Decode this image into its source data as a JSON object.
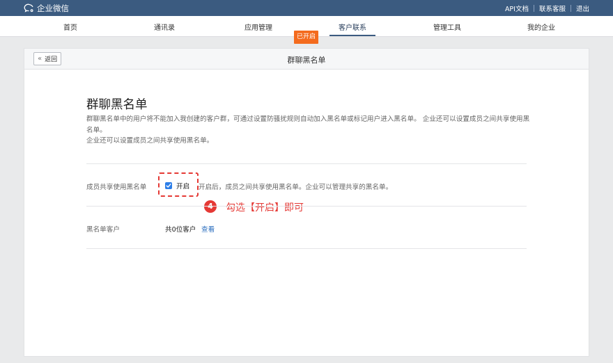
{
  "topbar": {
    "app_name": "企业微信",
    "links": [
      "API文档",
      "联系客服",
      "退出"
    ]
  },
  "nav": {
    "items": [
      "首页",
      "通讯录",
      "应用管理",
      "客户联系",
      "管理工具",
      "我的企业"
    ],
    "active_index": 3,
    "badge": "已开启"
  },
  "panel": {
    "back_label": "返回",
    "title": "群聊黑名单"
  },
  "content": {
    "heading": "群聊黑名单",
    "desc_line1": "群聊黑名单中的用户将不能加入我创建的客户群，可通过设置防骚扰规则自动加入黑名单或标记用户进入黑名单。 企业还可以设置成员之间共享使用黑名单。",
    "desc_line2": "企业还可以设置成员之间共享使用黑名单。",
    "share": {
      "label": "成员共享使用黑名单",
      "checkbox_label": "开启",
      "checked": true,
      "hint": "开启后，成员之间共享使用黑名单。企业可以管理共享的黑名单。"
    },
    "annotation": {
      "number": "4",
      "text": "勾选【开启】即可"
    },
    "blacklist": {
      "label": "黑名单客户",
      "count": "共0位客户",
      "link": "查看"
    }
  },
  "colors": {
    "topbar": "#3b5b80",
    "badge": "#f46b1e",
    "annotation": "#e53935",
    "checkbox": "#2d7ee8",
    "link": "#2d6fbf"
  }
}
